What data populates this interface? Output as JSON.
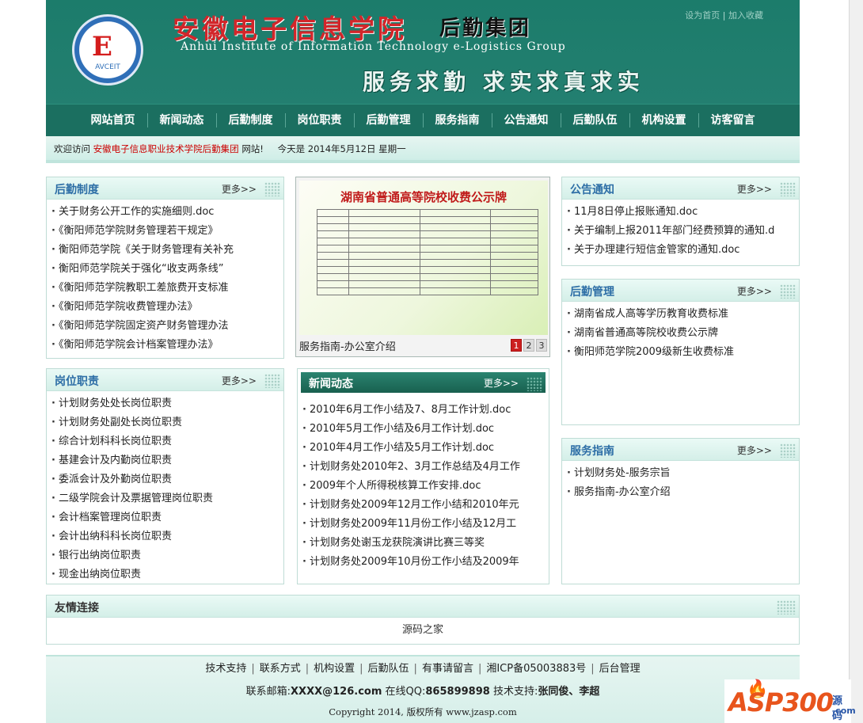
{
  "header": {
    "title_cn": "安徽电子信息学院",
    "title_cn2": "后勤集团",
    "title_en": "Anhui Institute of Information Technology e-Logistics Group",
    "slogan": "服务求勤 求实求真求实",
    "logo_abbr": "AVCEIT",
    "top_links": [
      "设为首页",
      "加入收藏"
    ]
  },
  "nav": [
    "网站首页",
    "新闻动态",
    "后勤制度",
    "岗位职责",
    "后勤管理",
    "服务指南",
    "公告通知",
    "后勤队伍",
    "机构设置",
    "访客留言"
  ],
  "welcome": {
    "prefix": "欢迎访问",
    "site": "安徽电子信息职业技术学院后勤集团",
    "suffix": "网站!",
    "date": "今天是 2014年5月12日 星期一"
  },
  "more": "更多>>",
  "boxes": {
    "houqin_zhidu": {
      "title": "后勤制度",
      "items": [
        "关于财务公开工作的实施细则.doc",
        "《衡阳师范学院财务管理若干规定》",
        "衡阳师范学院《关于财务管理有关补充",
        "衡阳师范学院关于强化“收支两条线”",
        "《衡阳师范学院教职工差旅费开支标准",
        "《衡阳师范学院收费管理办法》",
        "《衡阳师范学院固定资产财务管理办法",
        "《衡阳师范学院会计档案管理办法》"
      ]
    },
    "gangwei_zhize": {
      "title": "岗位职责",
      "items": [
        "计划财务处处长岗位职责",
        "计划财务处副处长岗位职责",
        "综合计划科科长岗位职责",
        "基建会计及内勤岗位职责",
        "委派会计及外勤岗位职责",
        "二级学院会计及票据管理岗位职责",
        "会计档案管理岗位职责",
        "会计出纳科科长岗位职责",
        "银行出纳岗位职责",
        "现金出纳岗位职责"
      ]
    },
    "xinwen": {
      "title": "新闻动态",
      "items": [
        "2010年6月工作小结及7、8月工作计划.doc",
        "2010年5月工作小结及6月工作计划.doc",
        "2010年4月工作小结及5月工作计划.doc",
        "计划财务处2010年2、3月工作总结及4月工作",
        "2009年个人所得税核算工作安排.doc",
        "计划财务处2009年12月工作小结和2010年元",
        "计划财务处2009年11月份工作小结及12月工",
        "计划财务处谢玉龙获院演讲比赛三等奖",
        "计划财务处2009年10月份工作小结及2009年"
      ]
    },
    "gonggao": {
      "title": "公告通知",
      "items": [
        "11月8日停止报账通知.doc",
        "关于编制上报2011年部门经费预算的通知.d",
        "关于办理建行短信金管家的通知.doc"
      ]
    },
    "houqin_guanli": {
      "title": "后勤管理",
      "items": [
        "湖南省成人高等学历教育收费标准",
        "湖南省普通高等院校收费公示牌",
        "衡阳师范学院2009级新生收费标准"
      ]
    },
    "fuwu_zhinan": {
      "title": "服务指南",
      "items": [
        "计划财务处-服务宗旨",
        "服务指南-办公室介绍"
      ]
    }
  },
  "slide": {
    "notice_title": "湖南省普通高等院校收费公示牌",
    "caption": "服务指南-办公室介绍",
    "pages": [
      "1",
      "2",
      "3"
    ],
    "active_page": 1
  },
  "friend": {
    "title": "友情连接",
    "link": "源码之家"
  },
  "footer": {
    "links": [
      "技术支持",
      "联系方式",
      "机构设置",
      "后勤队伍",
      "有事请留言",
      "湘ICP备05003883号",
      "后台管理"
    ],
    "contact_email_label": "联系邮箱:",
    "contact_email": "XXXX@126.com",
    "contact_qq_label": "在线QQ:",
    "contact_qq": "865899898",
    "tech_label": "技术支持:",
    "tech_names": "张同俊、李超",
    "copyright": "Copyright 2014, 版权所有 www.jzasp.com"
  },
  "watermark": {
    "brand": "ASP300",
    "side1": "源码",
    "side2": ".com"
  }
}
